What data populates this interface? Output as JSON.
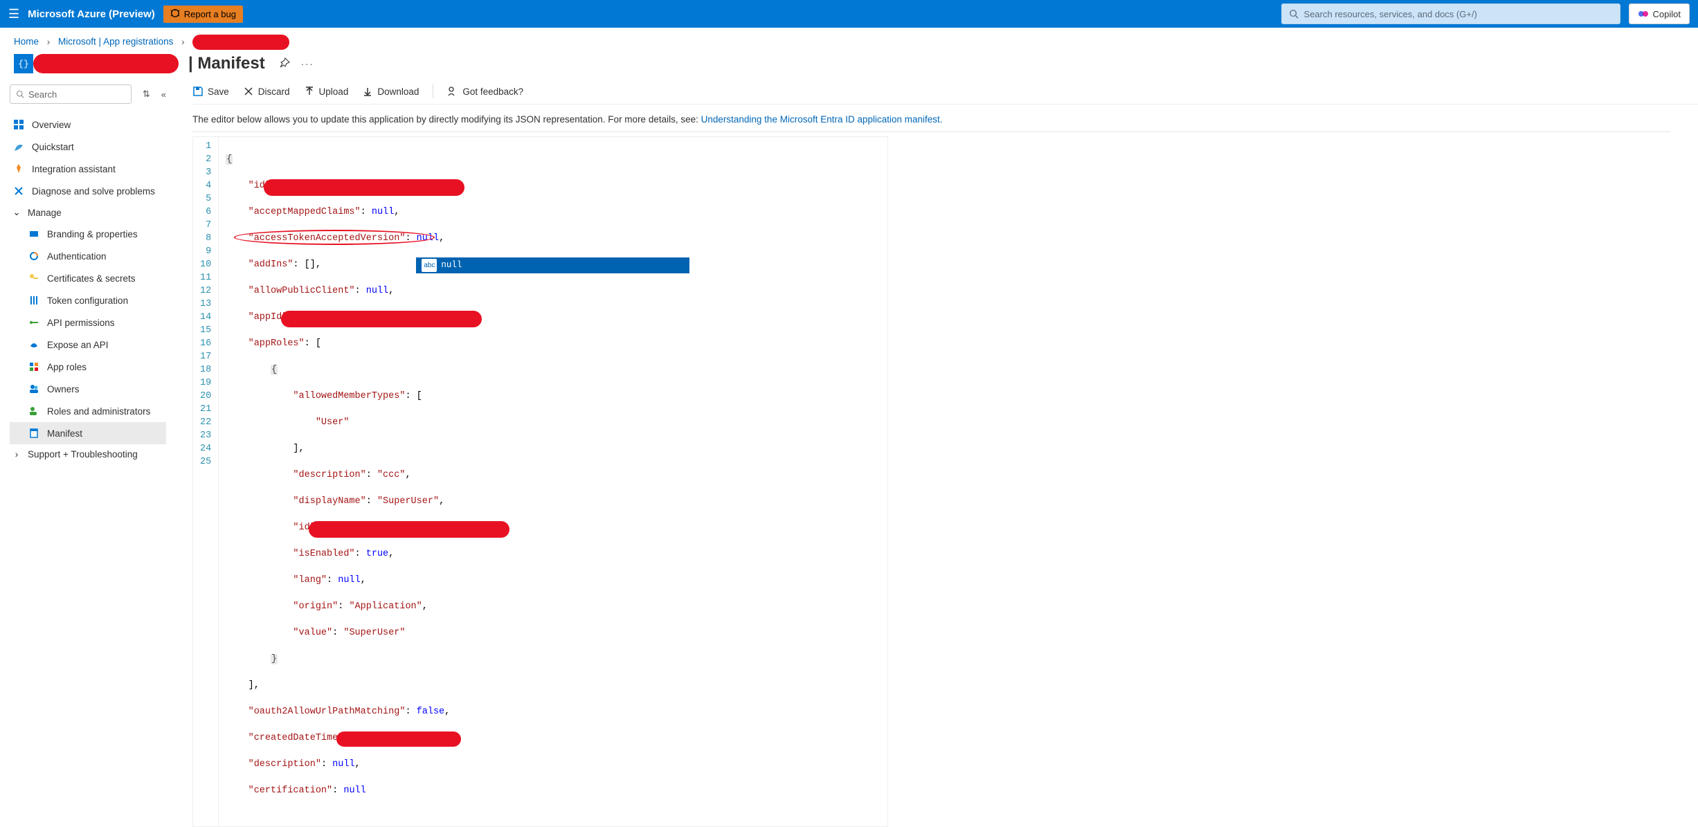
{
  "header": {
    "brand": "Microsoft Azure (Preview)",
    "report_bug": "Report a bug",
    "search_placeholder": "Search resources, services, and docs (G+/)",
    "copilot": "Copilot"
  },
  "breadcrumb": {
    "home": "Home",
    "parent": "Microsoft | App registrations"
  },
  "title": {
    "separator": "|",
    "page": "Manifest"
  },
  "sidebar": {
    "search_placeholder": "Search",
    "items": [
      {
        "label": "Overview",
        "indent": false
      },
      {
        "label": "Quickstart",
        "indent": false
      },
      {
        "label": "Integration assistant",
        "indent": false
      },
      {
        "label": "Diagnose and solve problems",
        "indent": false
      },
      {
        "label": "Manage",
        "indent": false,
        "chevron": true
      },
      {
        "label": "Branding & properties",
        "indent": true
      },
      {
        "label": "Authentication",
        "indent": true
      },
      {
        "label": "Certificates & secrets",
        "indent": true
      },
      {
        "label": "Token configuration",
        "indent": true
      },
      {
        "label": "API permissions",
        "indent": true
      },
      {
        "label": "Expose an API",
        "indent": true
      },
      {
        "label": "App roles",
        "indent": true
      },
      {
        "label": "Owners",
        "indent": true
      },
      {
        "label": "Roles and administrators",
        "indent": true
      },
      {
        "label": "Manifest",
        "indent": true,
        "selected": true
      },
      {
        "label": "Support + Troubleshooting",
        "indent": false,
        "chevron_right": true
      }
    ]
  },
  "commands": {
    "save": "Save",
    "discard": "Discard",
    "upload": "Upload",
    "download": "Download",
    "feedback": "Got feedback?"
  },
  "description": {
    "text": "The editor below allows you to update this application by directly modifying its JSON representation. For more details, see: ",
    "link": "Understanding the Microsoft Entra ID application manifest."
  },
  "editor": {
    "tooltip_hint": "null",
    "tooltip_abc": "abc",
    "lines": {
      "l1": "{",
      "id_key": "\"id\"",
      "acceptMapped_key": "\"acceptMappedClaims\"",
      "acceptMapped_val": "null",
      "accessToken_key": "\"accessTokenAcceptedVersion\"",
      "accessToken_val": "null",
      "addIns_key": "\"addIns\"",
      "addIns_val": "[]",
      "allowPublic_key": "\"allowPublicClient\"",
      "allowPublic_val": "null",
      "appId_key": "\"appId\"",
      "appRoles_key": "\"appRoles\"",
      "allowedMT_key": "\"allowedMemberTypes\"",
      "allowedMT_val": "\"User\"",
      "desc_key": "\"description\"",
      "desc_val": "\"ccc\"",
      "displayName_key": "\"displayName\"",
      "displayName_val": "\"SuperUser\"",
      "roleId_key": "\"id\"",
      "isEnabled_key": "\"isEnabled\"",
      "isEnabled_val": "true",
      "lang_key": "\"lang\"",
      "lang_val": "null",
      "origin_key": "\"origin\"",
      "origin_val": "\"Application\"",
      "value_key": "\"value\"",
      "value_val": "\"SuperUser\"",
      "oauth2_key": "\"oauth2AllowUrlPathMatching\"",
      "oauth2_val": "false",
      "created_key": "\"createdDateTime\"",
      "description2_key": "\"description\"",
      "description2_val": "null",
      "cert_key": "\"certification\"",
      "cert_val": "null"
    }
  }
}
